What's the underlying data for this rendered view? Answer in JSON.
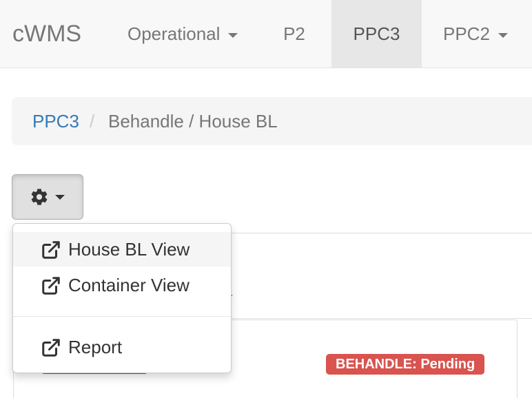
{
  "navbar": {
    "brand": "cWMS",
    "items": [
      {
        "label": "Operational",
        "dropdown": true,
        "active": false
      },
      {
        "label": "P2",
        "dropdown": false,
        "active": false
      },
      {
        "label": "PPC3",
        "dropdown": false,
        "active": true
      },
      {
        "label": "PPC2",
        "dropdown": true,
        "active": false
      }
    ]
  },
  "breadcrumb": {
    "link": "PPC3",
    "separator": "/",
    "current": "Behandle / House BL"
  },
  "actions_button": {
    "icon": "gear-icon",
    "caret": "caret-down-icon"
  },
  "dropdown_menu": {
    "items": [
      {
        "label": "House BL View",
        "icon": "external-link-icon",
        "highlighted": true
      },
      {
        "label": "Container View",
        "icon": "external-link-icon",
        "highlighted": false
      },
      {
        "label": "Report",
        "icon": "external-link-icon",
        "highlighted": false
      }
    ]
  },
  "status_badge": {
    "text": "BEHANDLE: Pending",
    "color": "#d9534f"
  },
  "colors": {
    "link": "#337ab7",
    "navbar_bg": "#f8f8f8",
    "navbar_active_bg": "#e7e7e7",
    "breadcrumb_bg": "#f5f5f5",
    "danger": "#d9534f"
  }
}
